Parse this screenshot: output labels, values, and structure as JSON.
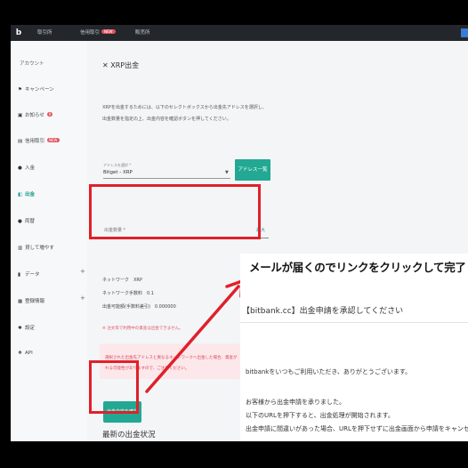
{
  "topbar": {
    "logo": "b",
    "nav": [
      "取引所",
      "信用取引",
      "販売所"
    ],
    "nav_badge": "NEW"
  },
  "sidebar": {
    "title": "アカウント",
    "items": [
      {
        "label": "キャンペーン",
        "icon": "flag-icon"
      },
      {
        "label": "お知らせ",
        "icon": "notice-icon",
        "badge": "9"
      },
      {
        "label": "信用取引",
        "icon": "margin-icon",
        "badge": "NEW"
      },
      {
        "label": "入金",
        "icon": "deposit-icon"
      },
      {
        "label": "出金",
        "icon": "withdraw-icon",
        "active": true
      },
      {
        "label": "両替",
        "icon": "exchange-icon"
      },
      {
        "label": "貸して増やす",
        "icon": "lending-icon"
      },
      {
        "label": "データ",
        "icon": "data-icon",
        "expandable": true
      },
      {
        "label": "登録情報",
        "icon": "profile-icon",
        "expandable": true
      },
      {
        "label": "設定",
        "icon": "gear-icon"
      },
      {
        "label": "API",
        "icon": "api-icon"
      }
    ],
    "plus": "+"
  },
  "main": {
    "close_glyph": "✕",
    "title": "XRP出金",
    "desc_lines": [
      "XRPを出金するためには、以下のセレクトボックスから出金先アドレスを選択し、",
      "出金数量を指定の上、出金内容を確認ボタンを押してください。"
    ],
    "address_select_label": "アドレスを選択 *",
    "address_select_value": "Bitget - XRP",
    "address_list_button": "アドレス一覧",
    "amount_label": "出金数量 *",
    "max_label": "最大",
    "network_lines": [
      "ネットワーク　XRP",
      "ネットワーク手数料　0.1",
      "出金可能額(手数料差引)　0.000000"
    ],
    "note": "※ 注文等で利用中の資産は出金できません。",
    "warning_lines": [
      "選択された出金先アドレスと異なるネットワークへ出金した場合、資産が",
      "れる可能性がありますので、ご注意ください。"
    ],
    "confirm_button": "出金内容を確認",
    "recent_title": "最新の出金状況"
  },
  "email": {
    "callout": "メールが届くのでリンクをクリックして完了",
    "subject": "【bitbank.cc】出金申請を承認してください",
    "body_lines": [
      "bitbankをいつもご利用いただき、ありがとうございます。",
      "お客様から出金申請を承りました。",
      "以下のURLを押下すると、出金処理が開始されます。",
      "出金申請に間違いがあった場合、URLを押下せずに出金画面から申請をキャンセルす"
    ]
  },
  "colors": {
    "accent": "#22a893",
    "highlight": "#e0202a",
    "topbar": "#23262b"
  }
}
